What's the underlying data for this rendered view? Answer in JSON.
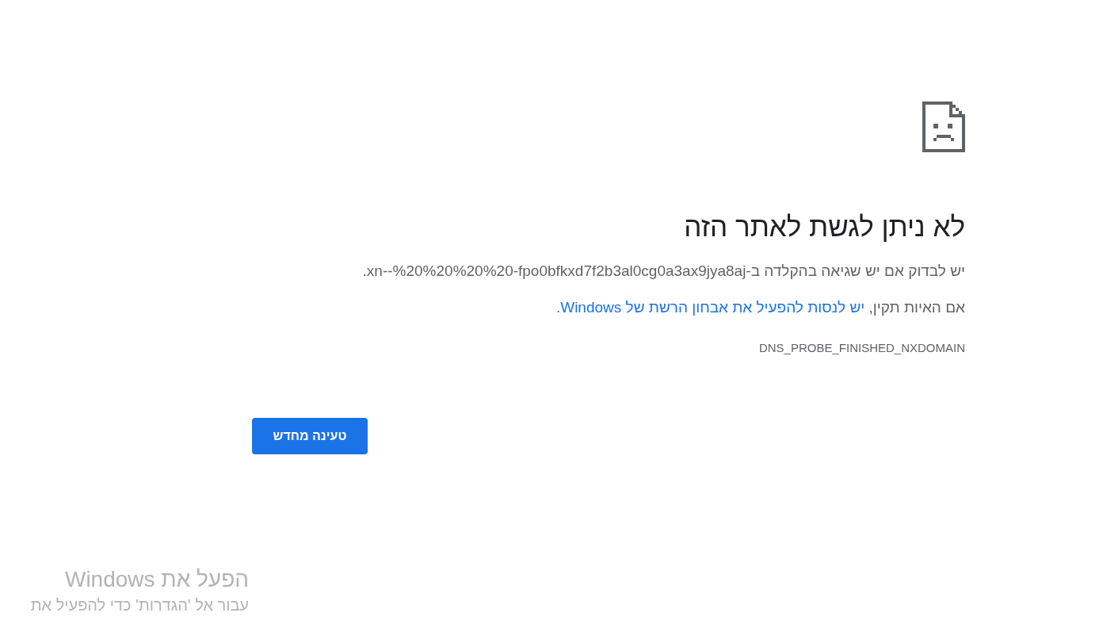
{
  "error_page": {
    "title": "לא ניתן לגשת לאתר הזה",
    "summary": "יש לבדוק אם יש שגיאה בהקלדה ב-xn--%20%20%20%20-fpo0bfkxd7f2b3al0cg0a3ax9jya8aj.",
    "suggestion": {
      "prefix": "אם האיות תקין, ",
      "link": "יש לנסות להפעיל את אבחון הרשת של Windows",
      "suffix": "."
    },
    "error_code": "DNS_PROBE_FINISHED_NXDOMAIN",
    "reload_button": "טעינה מחדש"
  },
  "activation_notice": {
    "title": "הפעל את Windows",
    "subtitle": "עבור אל 'הגדרות' כדי להפעיל את"
  }
}
